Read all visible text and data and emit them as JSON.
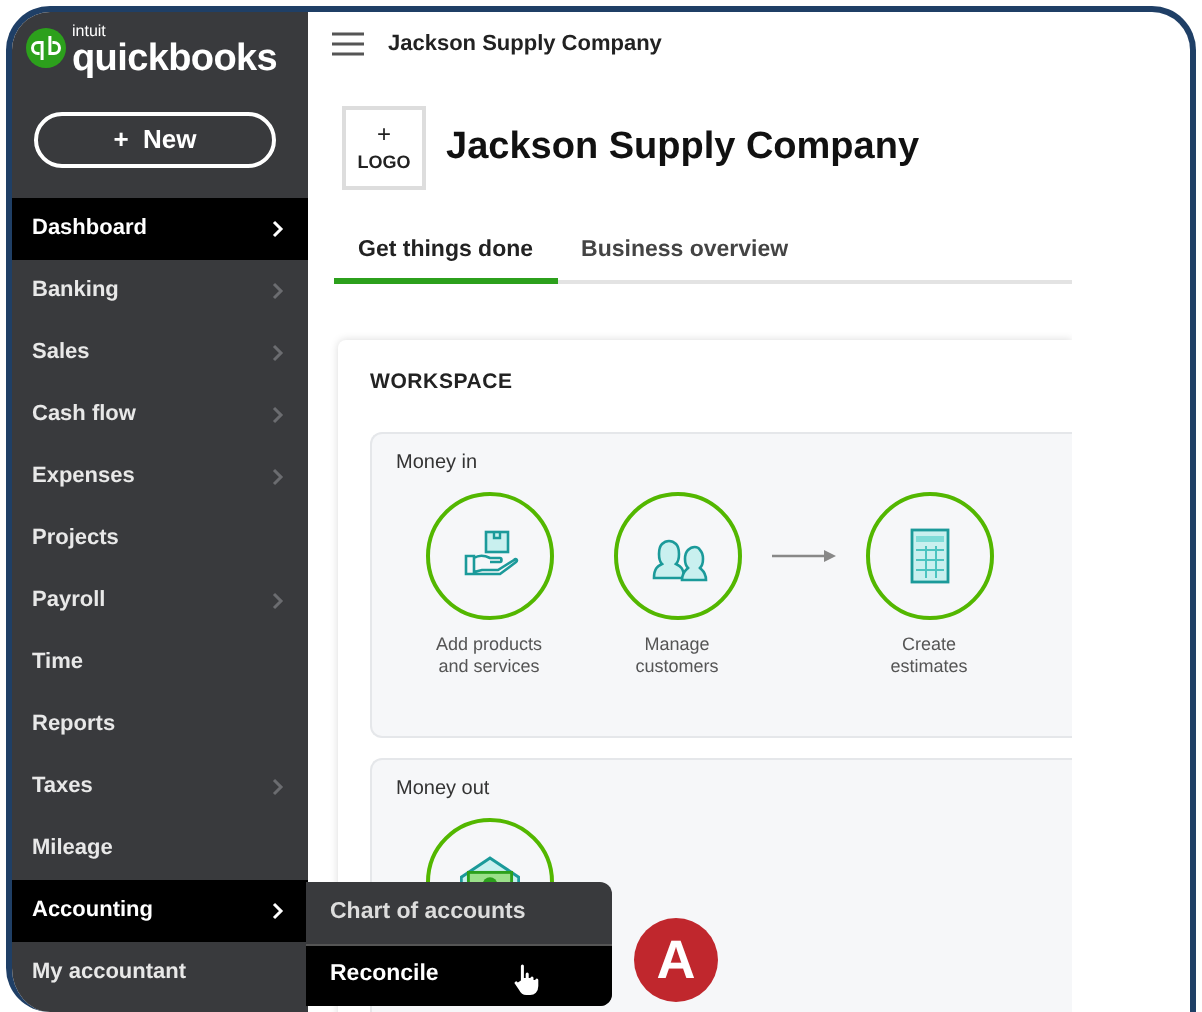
{
  "brand": {
    "small": "intuit",
    "name": "quickbooks"
  },
  "new_button": {
    "icon": "+",
    "label": "New"
  },
  "sidebar": {
    "items": [
      {
        "label": "Dashboard",
        "highlighted": true,
        "submenu": true
      },
      {
        "label": "Banking",
        "highlighted": false,
        "submenu": true
      },
      {
        "label": "Sales",
        "highlighted": false,
        "submenu": true
      },
      {
        "label": "Cash flow",
        "highlighted": false,
        "submenu": true
      },
      {
        "label": "Expenses",
        "highlighted": false,
        "submenu": true
      },
      {
        "label": "Projects",
        "highlighted": false,
        "submenu": false
      },
      {
        "label": "Payroll",
        "highlighted": false,
        "submenu": true
      },
      {
        "label": "Time",
        "highlighted": false,
        "submenu": false
      },
      {
        "label": "Reports",
        "highlighted": false,
        "submenu": false
      },
      {
        "label": "Taxes",
        "highlighted": false,
        "submenu": true
      },
      {
        "label": "Mileage",
        "highlighted": false,
        "submenu": false
      },
      {
        "label": "Accounting",
        "highlighted": true,
        "submenu": true
      },
      {
        "label": "My accountant",
        "highlighted": false,
        "submenu": false
      }
    ]
  },
  "flyout": {
    "items": [
      {
        "label": "Chart of accounts",
        "hovered": false
      },
      {
        "label": "Reconcile",
        "hovered": true
      }
    ]
  },
  "topbar": {
    "company": "Jackson Supply Company"
  },
  "logo_button": {
    "icon": "+",
    "label": "LOGO"
  },
  "company_name": "Jackson Supply Company",
  "tabs": [
    {
      "label": "Get things done",
      "selected": true
    },
    {
      "label": "Business overview",
      "selected": false
    }
  ],
  "workspace": {
    "title": "WORKSPACE",
    "sections": [
      {
        "title": "Money in",
        "tasks": [
          {
            "kind": "products",
            "label": "Add products and services",
            "arrow_before": false
          },
          {
            "kind": "customers",
            "label": "Manage customers",
            "arrow_before": false
          },
          {
            "kind": "estimates",
            "label": "Create estimates",
            "arrow_before": true
          }
        ]
      },
      {
        "title": "Money out",
        "tasks": [
          {
            "kind": "money",
            "arrow_before": false
          }
        ]
      }
    ]
  },
  "annotation": {
    "letter": "A"
  }
}
